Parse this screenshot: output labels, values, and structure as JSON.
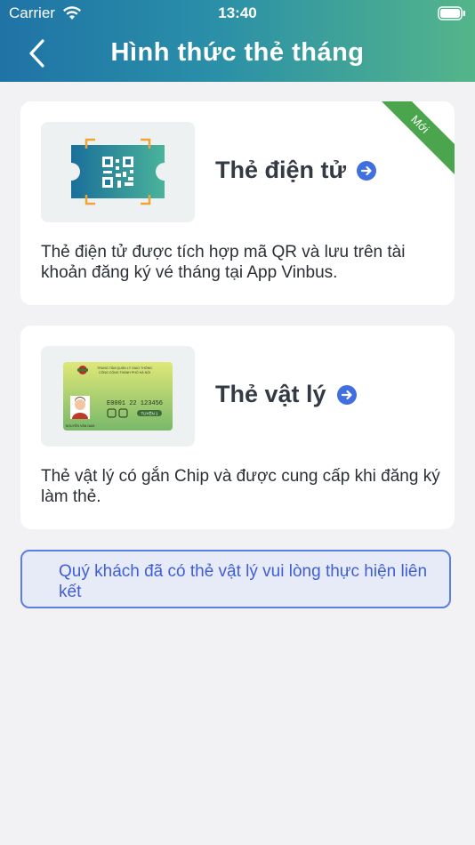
{
  "status_bar": {
    "carrier": "Carrier",
    "time": "13:40"
  },
  "header": {
    "title": "Hình thức thẻ tháng"
  },
  "cards": [
    {
      "title": "Thẻ điện tử",
      "badge": "Mới",
      "description": "Thẻ điện tử được tích hợp mã QR và lưu trên tài khoản đăng ký vé tháng tại App Vinbus."
    },
    {
      "title": "Thẻ vật lý",
      "description": "Thẻ vật lý có gắn Chip và được cung cấp khi đăng ký làm thẻ.",
      "card_image": {
        "header_line1": "TRUNG TÂM QUẢN LÝ GIAO THÔNG",
        "header_line2": "CÔNG CỘNG THÀNH PHỐ HÀ NỘI",
        "number": "E0001 22 123456",
        "route": "TUYẾN 1 ",
        "holder": "NGUYỄN VĂN NAM"
      }
    }
  ],
  "notice": {
    "text": "Quý khách đã có thẻ vật lý vui lòng thực hiện liên kết"
  },
  "colors": {
    "accent": "#3f5fd6",
    "badge": "#4aa54c",
    "header_start": "#1f73a6",
    "header_end": "#54b58a"
  }
}
